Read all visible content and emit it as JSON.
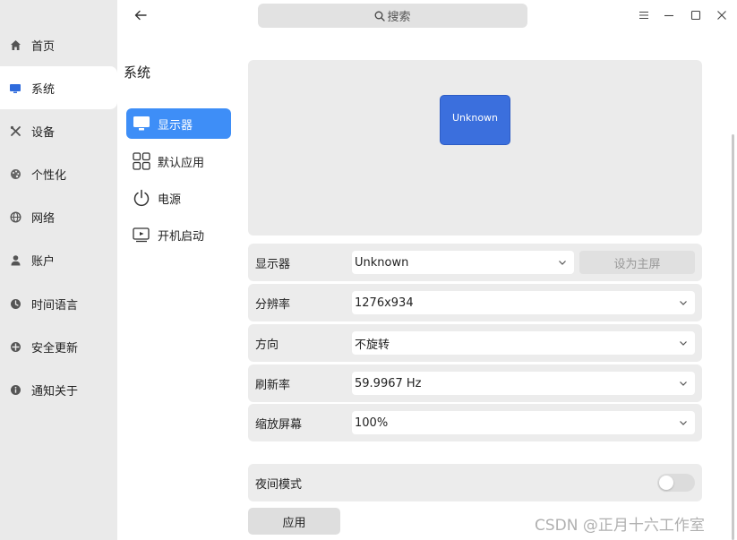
{
  "nav": {
    "items": [
      {
        "label": "首页",
        "icon": "home-icon"
      },
      {
        "label": "系统",
        "icon": "monitor-icon"
      },
      {
        "label": "设备",
        "icon": "tools-icon"
      },
      {
        "label": "个性化",
        "icon": "palette-icon"
      },
      {
        "label": "网络",
        "icon": "globe-icon"
      },
      {
        "label": "账户",
        "icon": "user-icon"
      },
      {
        "label": "时间语言",
        "icon": "clock-icon"
      },
      {
        "label": "安全更新",
        "icon": "shield-icon"
      },
      {
        "label": "通知关于",
        "icon": "info-icon"
      }
    ],
    "active_index": 1
  },
  "subnav": {
    "title": "系统",
    "items": [
      {
        "label": "显示器",
        "icon": "display-icon"
      },
      {
        "label": "默认应用",
        "icon": "apps-grid-icon"
      },
      {
        "label": "电源",
        "icon": "power-icon"
      },
      {
        "label": "开机启动",
        "icon": "startup-icon"
      }
    ],
    "active_index": 0
  },
  "search": {
    "label": "搜索"
  },
  "preview": {
    "monitor_label": "Unknown"
  },
  "settings": {
    "display": {
      "label": "显示器",
      "value": "Unknown",
      "primary_button": "设为主屏"
    },
    "resolution": {
      "label": "分辨率",
      "value": "1276x934"
    },
    "orientation": {
      "label": "方向",
      "value": "不旋转"
    },
    "refresh": {
      "label": "刷新率",
      "value": "59.9967 Hz"
    },
    "scale": {
      "label": "缩放屏幕",
      "value": "100%"
    },
    "night_mode": {
      "label": "夜间模式",
      "enabled": false
    }
  },
  "apply_label": "应用",
  "watermark": "CSDN @正月十六工作室",
  "colors": {
    "accent": "#3e8ef7",
    "monitor_box": "#3b6fdd"
  }
}
